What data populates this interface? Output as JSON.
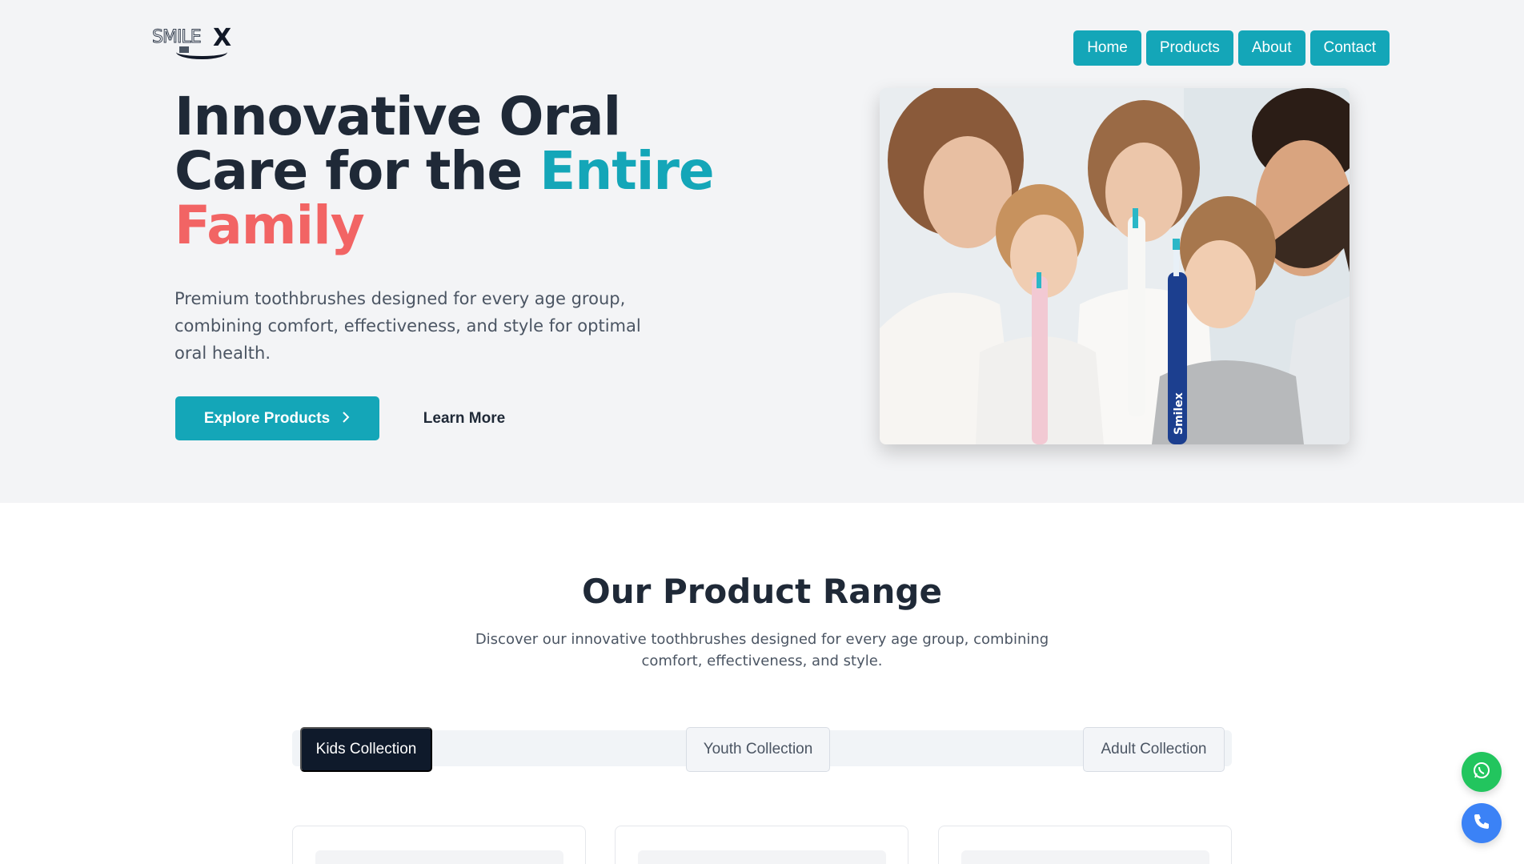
{
  "brand": {
    "logo_text": "SMILE",
    "logo_x": "X"
  },
  "nav": {
    "items": [
      "Home",
      "Products",
      "About",
      "Contact"
    ]
  },
  "hero": {
    "title_line1": "Innovative Oral",
    "title_line2_prefix": "Care for the ",
    "title_line2_accent": "Entire",
    "title_line3": "Family",
    "description": "Premium toothbrushes designed for every age group, combining comfort, effectiveness, and style for optimal oral health.",
    "explore_label": "Explore Products",
    "learn_label": "Learn More",
    "image_toothbrush_label": "Smilex"
  },
  "products": {
    "title": "Our Product Range",
    "description": "Discover our innovative toothbrushes designed for every age group, combining comfort, effectiveness, and style.",
    "tabs": [
      "Kids Collection",
      "Youth Collection",
      "Adult Collection"
    ]
  },
  "colors": {
    "primary": "#14a6b8",
    "coral": "#f26464",
    "dark": "#1f2937",
    "whatsapp": "#22c55e",
    "call": "#3b82f6"
  },
  "icons": [
    "chevron-right-icon",
    "whatsapp-icon",
    "phone-icon"
  ]
}
